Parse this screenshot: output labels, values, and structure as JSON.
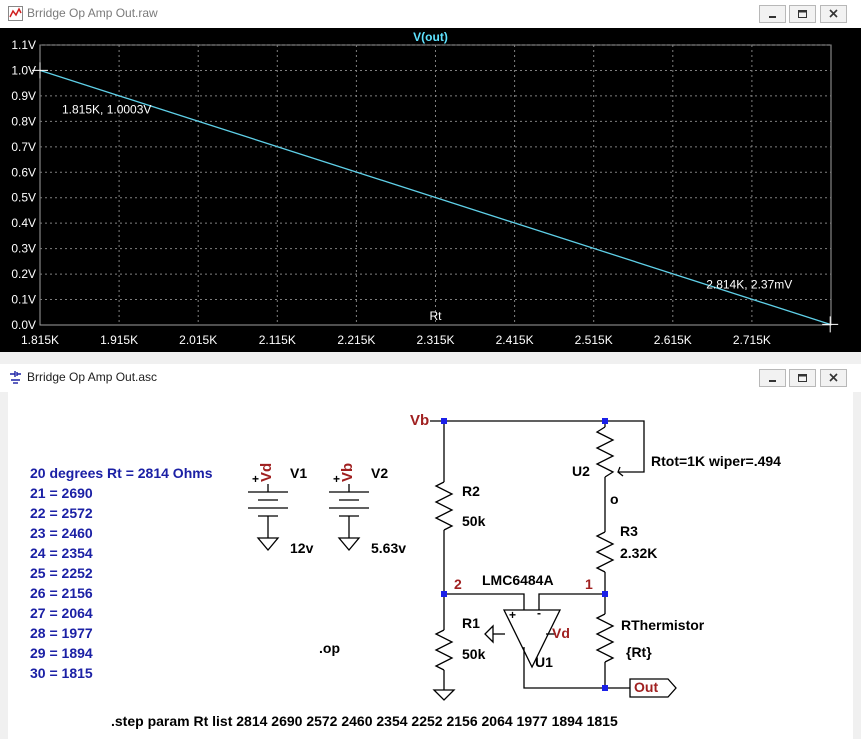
{
  "plot_window": {
    "title": "Brridge Op Amp Out.raw",
    "icon": "waveform-icon"
  },
  "schematic_window": {
    "title": "Brridge Op Amp Out.asc",
    "icon": "schematic-icon"
  },
  "chart_data": {
    "type": "line",
    "title": "V(out)",
    "xlabel": "Rt",
    "ylabel": "",
    "xlim": [
      1815,
      2815
    ],
    "ylim": [
      0,
      1.1
    ],
    "x_ticks": [
      "1.815K",
      "1.915K",
      "2.015K",
      "2.115K",
      "2.215K",
      "2.315K",
      "2.415K",
      "2.515K",
      "2.615K",
      "2.715K"
    ],
    "y_ticks": [
      "0.0V",
      "0.1V",
      "0.2V",
      "0.3V",
      "0.4V",
      "0.5V",
      "0.6V",
      "0.7V",
      "0.8V",
      "0.9V",
      "1.0V",
      "1.1V"
    ],
    "grid": true,
    "series": [
      {
        "name": "V(out)",
        "color": "#5fd0e8",
        "x": [
          1815,
          2814
        ],
        "y": [
          1.0003,
          0.00237
        ]
      }
    ],
    "annotations": [
      {
        "text": "1.815K, 1.0003V",
        "x": 1815,
        "y": 1.0003
      },
      {
        "text": "2.814K, 2.37mV",
        "x": 2814,
        "y": 0.00237
      }
    ]
  },
  "schematic": {
    "temperature_table": [
      "20 degrees Rt = 2814 Ohms",
      "21 = 2690",
      "22 = 2572",
      "23 = 2460",
      "24 = 2354",
      "25 = 2252",
      "26 = 2156",
      "27 = 2064",
      "28 = 1977",
      "29 = 1894",
      "30 = 1815"
    ],
    "sources": {
      "v1_name": "V1",
      "v1_net": "Vd",
      "v1_value": "12v",
      "v2_name": "V2",
      "v2_net": "Vb",
      "v2_value": "5.63v",
      "plus": "+"
    },
    "nets": {
      "vb": "Vb",
      "vd": "Vd",
      "out": "Out",
      "node2": "2",
      "node1": "1"
    },
    "components": {
      "r2_name": "R2",
      "r2_value": "50k",
      "r1_name": "R1",
      "r1_value": "50k",
      "r3_name": "R3",
      "r3_value": "2.32K",
      "u2_name": "U2",
      "u2_params": "Rtot=1K wiper=.494",
      "u2_wiper": "o",
      "rt_name": "RThermistor",
      "rt_value": "{Rt}",
      "u1_name": "U1",
      "u1_model": "LMC6484A",
      "plus_pin": "+",
      "minus_pin": "-"
    },
    "directives": {
      "op": ".op",
      "step": ".step param Rt list 2814 2690 2572 2460  2354  2252 2156  2064 1977 1894 1815"
    }
  }
}
